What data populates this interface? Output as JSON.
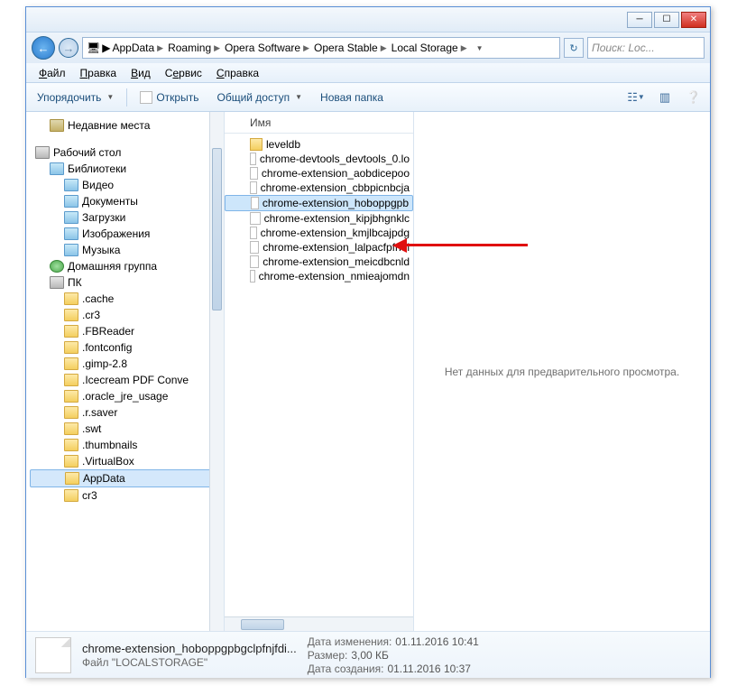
{
  "breadcrumb": [
    "AppData",
    "Roaming",
    "Opera Software",
    "Opera Stable",
    "Local Storage"
  ],
  "search_placeholder": "Поиск: Loc...",
  "menu": {
    "file": "Файл",
    "edit": "Правка",
    "view": "Вид",
    "tools": "Сервис",
    "help": "Справка"
  },
  "toolbar": {
    "organize": "Упорядочить",
    "open": "Открыть",
    "share": "Общий доступ",
    "newfolder": "Новая папка"
  },
  "nav": {
    "recent": "Недавние места",
    "desktop": "Рабочий стол",
    "libraries": "Библиотеки",
    "video": "Видео",
    "documents": "Документы",
    "downloads": "Загрузки",
    "pictures": "Изображения",
    "music": "Музыка",
    "homegroup": "Домашняя группа",
    "pc": "ПК",
    "folders": [
      ".cache",
      ".cr3",
      ".FBReader",
      ".fontconfig",
      ".gimp-2.8",
      ".Icecream PDF Conve",
      ".oracle_jre_usage",
      ".r.saver",
      ".swt",
      ".thumbnails",
      ".VirtualBox",
      "AppData",
      "cr3"
    ]
  },
  "col_name": "Имя",
  "files": [
    {
      "name": "leveldb",
      "type": "folder"
    },
    {
      "name": "chrome-devtools_devtools_0.lo",
      "type": "file"
    },
    {
      "name": "chrome-extension_aobdicepoo",
      "type": "file"
    },
    {
      "name": "chrome-extension_cbbpicnbcja",
      "type": "file"
    },
    {
      "name": "chrome-extension_hoboppgpb",
      "type": "file",
      "selected": true
    },
    {
      "name": "chrome-extension_kipjbhgnklc",
      "type": "file"
    },
    {
      "name": "chrome-extension_kmjlbcajpdg",
      "type": "file"
    },
    {
      "name": "chrome-extension_lalpacfpfnol",
      "type": "file"
    },
    {
      "name": "chrome-extension_meicdbcnld",
      "type": "file"
    },
    {
      "name": "chrome-extension_nmieajomdn",
      "type": "file"
    }
  ],
  "preview_empty": "Нет данных для предварительного просмотра.",
  "details": {
    "name": "chrome-extension_hoboppgpbgclpfnjfdi...",
    "type": "Файл \"LOCALSTORAGE\"",
    "mod_label": "Дата изменения:",
    "mod": "01.11.2016 10:41",
    "size_label": "Размер:",
    "size": "3,00 КБ",
    "created_label": "Дата создания:",
    "created": "01.11.2016 10:37"
  }
}
